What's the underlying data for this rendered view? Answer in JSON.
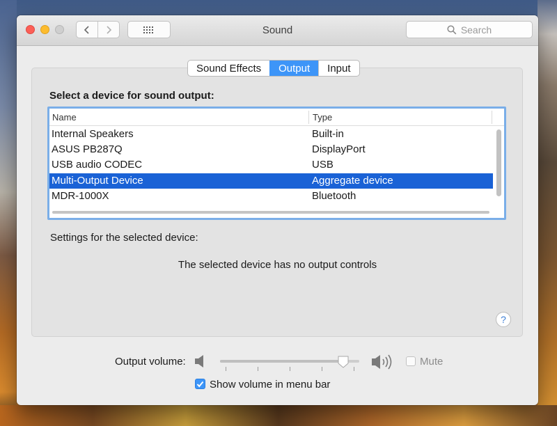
{
  "window": {
    "title": "Sound"
  },
  "toolbar": {
    "back_icon": "chevron-left-icon",
    "forward_icon": "chevron-right-icon",
    "grid_icon": "grid-icon",
    "search": {
      "placeholder": "Search",
      "icon": "search-icon"
    }
  },
  "tabs": [
    {
      "label": "Sound Effects",
      "active": false
    },
    {
      "label": "Output",
      "active": true
    },
    {
      "label": "Input",
      "active": false
    }
  ],
  "output": {
    "heading": "Select a device for sound output:",
    "columns": [
      "Name",
      "Type"
    ],
    "devices": [
      {
        "name": "Internal Speakers",
        "type": "Built-in"
      },
      {
        "name": "ASUS PB287Q",
        "type": "DisplayPort"
      },
      {
        "name": "USB audio CODEC",
        "type": "USB"
      },
      {
        "name": "Multi-Output Device",
        "type": "Aggregate device",
        "selected": true
      },
      {
        "name": "MDR-1000X",
        "type": "Bluetooth"
      }
    ],
    "settings_label": "Settings for the selected device:",
    "no_controls_text": "The selected device has no output controls",
    "help_label": "?"
  },
  "volume": {
    "label": "Output volume:",
    "level": 0.92,
    "mute_label": "Mute",
    "mute_checked": false,
    "show_in_menu_bar_label": "Show volume in menu bar",
    "show_in_menu_bar_checked": true
  },
  "colors": {
    "accent": "#3d95f8",
    "selection": "#1a62d6",
    "close": "#fc5f57",
    "minimize": "#fdbc2e"
  }
}
